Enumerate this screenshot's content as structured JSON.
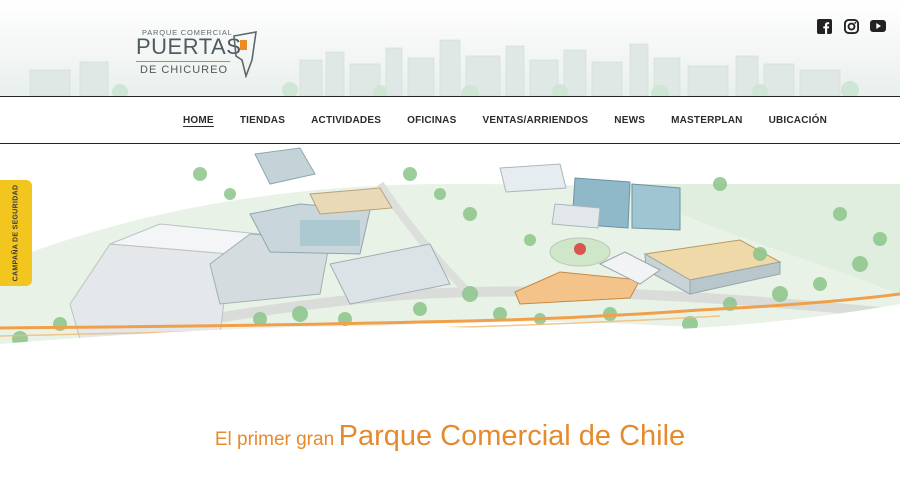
{
  "logo": {
    "top_line": "PARQUE COMERCIAL",
    "name": "PUERTAS",
    "sub": "DE CHICUREO"
  },
  "social": [
    {
      "icon": "facebook-icon"
    },
    {
      "icon": "instagram-icon"
    },
    {
      "icon": "youtube-icon"
    }
  ],
  "nav": {
    "items": [
      {
        "label": "HOME",
        "active": true
      },
      {
        "label": "TIENDAS"
      },
      {
        "label": "ACTIVIDADES"
      },
      {
        "label": "OFICINAS"
      },
      {
        "label": "VENTAS/ARRIENDOS"
      },
      {
        "label": "NEWS"
      },
      {
        "label": "MASTERPLAN"
      },
      {
        "label": "UBICACIÓN"
      }
    ]
  },
  "side_tab": {
    "label": "CAMPAÑA DE SEGURIDAD"
  },
  "tagline": {
    "small": "El primer gran",
    "big": "Parque Comercial de Chile"
  },
  "colors": {
    "accent_orange": "#e68a2e",
    "side_tab_yellow": "#f2c61f",
    "logo_orange": "#f08a24"
  }
}
